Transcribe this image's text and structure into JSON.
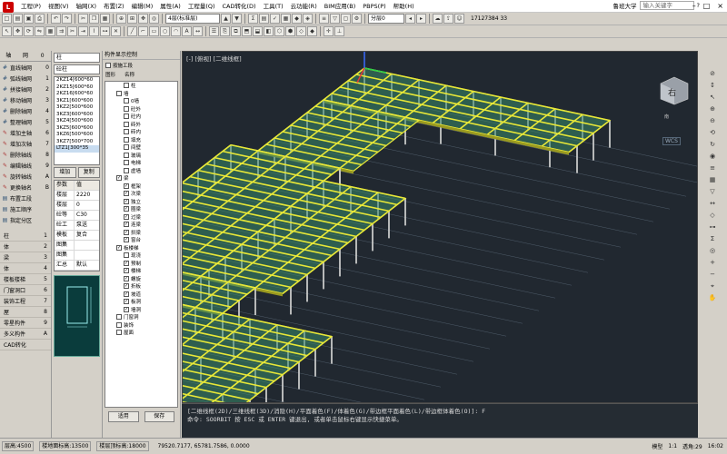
{
  "menu": {
    "items": [
      "工程(P)",
      "视图(V)",
      "轴网(X)",
      "布置(Z)",
      "编辑(M)",
      "属性(A)",
      "工程量(Q)",
      "CAD转化(D)",
      "工具(T)",
      "云功能(R)",
      "BIM应用(B)",
      "PBPS(P)",
      "帮助(H)"
    ],
    "user": "鲁班大学",
    "search_placeholder": "输入关键字",
    "phone": "17127384 33",
    "win_controls": [
      "–",
      "□",
      "×"
    ]
  },
  "toolbar": {
    "floor_select": "4层(标准层)",
    "layer_select": "分层0",
    "toolbar2_hint": ""
  },
  "left_panel": {
    "tabs": [
      "轴",
      "网",
      "0"
    ],
    "items": [
      {
        "icon": "grid-icon",
        "label": "直线轴网",
        "key": "0"
      },
      {
        "icon": "grid-icon",
        "label": "弧线轴网",
        "key": "1"
      },
      {
        "icon": "grid-icon",
        "label": "拼接轴网",
        "key": "2"
      },
      {
        "icon": "grid-icon",
        "label": "移动轴网",
        "key": "3"
      },
      {
        "icon": "grid-icon",
        "label": "删除轴网",
        "key": "4"
      },
      {
        "icon": "grid-icon",
        "label": "整理轴网",
        "key": "5"
      },
      {
        "icon": "pencil-icon",
        "label": "增加主轴",
        "key": "6"
      },
      {
        "icon": "pencil-icon",
        "label": "增加次轴",
        "key": "7"
      },
      {
        "icon": "pencil-icon",
        "label": "删除轴线",
        "key": "8"
      },
      {
        "icon": "pencil-icon",
        "label": "编辑轴线",
        "key": "9"
      },
      {
        "icon": "pencil-icon",
        "label": "旋转轴线",
        "key": "A"
      },
      {
        "icon": "pencil-icon",
        "label": "更换轴名",
        "key": "B"
      },
      {
        "icon": "layout-icon",
        "label": "布置工段",
        "key": ""
      },
      {
        "icon": "layout-icon",
        "label": "施工顺序",
        "key": ""
      },
      {
        "icon": "layout-icon",
        "label": "指定分区",
        "key": ""
      }
    ],
    "categories": [
      {
        "label": "柱",
        "key": "1"
      },
      {
        "label": "体",
        "key": "2"
      },
      {
        "label": "梁",
        "key": "3"
      },
      {
        "label": "体",
        "key": "4"
      },
      {
        "label": "楼板楼梯",
        "key": "5"
      },
      {
        "label": "门窗洞口",
        "key": "6"
      },
      {
        "label": "装饰工程",
        "key": "7"
      },
      {
        "label": "屋",
        "key": "8"
      },
      {
        "label": "零星构件",
        "key": "9"
      },
      {
        "label": "多义构件",
        "key": "A"
      },
      {
        "label": "CAD转化",
        "key": ""
      }
    ]
  },
  "component_panel": {
    "type_select": "柱",
    "subtype_select": "砼柱",
    "components": [
      "2KZ14[600*60",
      "2KZ15[600*60",
      "2KZ16[600*60",
      "3KZ1[600*600",
      "3KZ2[500*600",
      "3KZ3[600*600",
      "3KZ4[500*600",
      "3KZ5[600*600",
      "3KZ6[500*600",
      "3KZ7[500*700",
      "LTZ1[300*35"
    ],
    "selected_index": 10,
    "add_label": "增加",
    "copy_label": "复制",
    "prop_header": [
      "参数",
      "值"
    ],
    "props": [
      [
        "楼层",
        "2220"
      ],
      [
        "楼层",
        "0"
      ],
      [
        "砼等",
        "C30"
      ],
      [
        "砼工",
        "泵送"
      ],
      [
        "模板",
        "复合"
      ],
      [
        "图集",
        ""
      ],
      [
        "图集",
        ""
      ],
      [
        "汇总",
        "默认"
      ]
    ]
  },
  "visibility_panel": {
    "title": "构件显示控制",
    "hide_check_label": "按施工段",
    "col_icon": "图形",
    "col_name": "名称",
    "rows": [
      {
        "indent": 2,
        "checked": false,
        "label": "柱"
      },
      {
        "indent": 1,
        "checked": false,
        "label": "墙"
      },
      {
        "indent": 2,
        "checked": false,
        "label": "0墙"
      },
      {
        "indent": 2,
        "checked": false,
        "label": "砼外"
      },
      {
        "indent": 2,
        "checked": false,
        "label": "砼内"
      },
      {
        "indent": 2,
        "checked": false,
        "label": "砖外"
      },
      {
        "indent": 2,
        "checked": false,
        "label": "砖内"
      },
      {
        "indent": 2,
        "checked": false,
        "label": "填充"
      },
      {
        "indent": 2,
        "checked": false,
        "label": "间壁"
      },
      {
        "indent": 2,
        "checked": false,
        "label": "玻璃"
      },
      {
        "indent": 2,
        "checked": false,
        "label": "电梯"
      },
      {
        "indent": 2,
        "checked": false,
        "label": "虚墙"
      },
      {
        "indent": 1,
        "checked": true,
        "label": "梁"
      },
      {
        "indent": 2,
        "checked": true,
        "label": "框架"
      },
      {
        "indent": 2,
        "checked": true,
        "label": "次梁"
      },
      {
        "indent": 2,
        "checked": true,
        "label": "独立"
      },
      {
        "indent": 2,
        "checked": true,
        "label": "圈梁"
      },
      {
        "indent": 2,
        "checked": true,
        "label": "过梁"
      },
      {
        "indent": 2,
        "checked": true,
        "label": "连梁"
      },
      {
        "indent": 2,
        "checked": true,
        "label": "拱梁"
      },
      {
        "indent": 2,
        "checked": true,
        "label": "窗台"
      },
      {
        "indent": 1,
        "checked": true,
        "label": "板楼梯"
      },
      {
        "indent": 2,
        "checked": false,
        "label": "现浇"
      },
      {
        "indent": 2,
        "checked": true,
        "label": "预制"
      },
      {
        "indent": 2,
        "checked": true,
        "label": "楼梯"
      },
      {
        "indent": 2,
        "checked": true,
        "label": "螺旋"
      },
      {
        "indent": 2,
        "checked": true,
        "label": "折板"
      },
      {
        "indent": 2,
        "checked": true,
        "label": "坡道"
      },
      {
        "indent": 2,
        "checked": true,
        "label": "板洞"
      },
      {
        "indent": 2,
        "checked": true,
        "label": "墙洞"
      },
      {
        "indent": 1,
        "checked": false,
        "label": "门窗洞"
      },
      {
        "indent": 1,
        "checked": false,
        "label": "装饰"
      },
      {
        "indent": 1,
        "checked": false,
        "label": "屋面"
      }
    ],
    "apply_label": "适用",
    "save_label": "保存"
  },
  "viewport": {
    "label": "[-] [俯视] [二维线框]",
    "view_cube_label": "右",
    "wcs_label": "WCS",
    "nav_label": "南"
  },
  "command": {
    "line1": "[二维线框(2D)/三维线框(3D)/消隐(H)/平面着色(F)/体着色(G)/带边框平面着色(L)/带边框体着色(O)]: F",
    "line2": "命令: SOORBIT 按 ESC 或 ENTER 键退出, 或者单击鼠标右键显示快捷菜单。"
  },
  "status": {
    "floor": "层高:4500",
    "floor_bottom": "楼地面标高:13500",
    "floor_top": "楼层顶标高:18000",
    "coords": "79520.7177, 65781.7586, 0.0000",
    "model_label": "模型",
    "scale": "1:1",
    "ratio": "透角:29",
    "time": "16:02"
  },
  "colors": {
    "beam": "#e8e838",
    "slab": "#3a8a6a",
    "column": "#c8c8c8",
    "grid": "#5a6a78",
    "viewport_bg": "#212830"
  }
}
